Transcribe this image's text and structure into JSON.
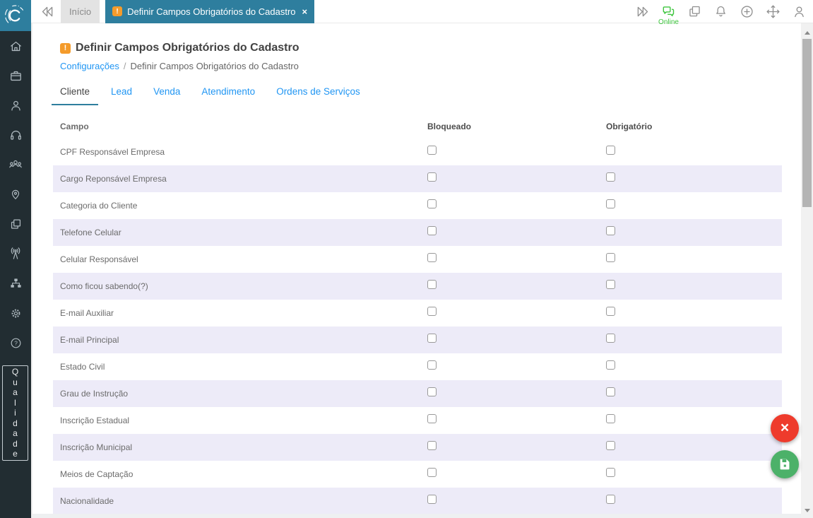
{
  "colors": {
    "accent": "#2e7e9e",
    "link_blue": "#2196f3",
    "online_green": "#3dc53d",
    "save_green": "#4cb169",
    "cancel_red": "#ee3b2c",
    "warning_orange": "#f49b2b",
    "sidebar_bg": "#222d32",
    "sidebar_icon": "#aeb9bf",
    "row_alt": "#edebf8",
    "inactive_tab_bg": "#e3e3e3"
  },
  "topbar": {
    "tabs": [
      {
        "label": "Início",
        "active": false
      },
      {
        "label": "Definir Campos Obrigatórios do Cadastro",
        "active": true,
        "warning_glyph": "!",
        "close_glyph": "×"
      }
    ],
    "right_icons": [
      "fast-forward-icon",
      "chat-icon",
      "copy-icon",
      "bell-icon",
      "add-circle-icon",
      "move-icon",
      "user-icon"
    ],
    "online_label": "Online"
  },
  "sidebar": {
    "icons": [
      "home-icon",
      "briefcase-icon",
      "user-icon",
      "headset-icon",
      "team-icon",
      "location-icon",
      "pages-icon",
      "broadcast-icon",
      "sitemap-icon",
      "settings-icon",
      "help-icon"
    ],
    "vertical_tab_label": "Qualidade"
  },
  "page": {
    "warning_glyph": "!",
    "title": "Definir Campos Obrigatórios do Cadastro",
    "breadcrumb": {
      "parent": "Configurações",
      "separator": "/",
      "current": "Definir Campos Obrigatórios do Cadastro"
    },
    "tabs": [
      {
        "label": "Cliente",
        "active": true
      },
      {
        "label": "Lead",
        "active": false
      },
      {
        "label": "Venda",
        "active": false
      },
      {
        "label": "Atendimento",
        "active": false
      },
      {
        "label": "Ordens de Serviços",
        "active": false
      }
    ]
  },
  "table": {
    "columns": [
      "Campo",
      "Bloqueado",
      "Obrigatório"
    ],
    "rows": [
      {
        "campo": "CPF Responsável Empresa",
        "bloqueado": false,
        "obrigatorio": false
      },
      {
        "campo": "Cargo Reponsável Empresa",
        "bloqueado": false,
        "obrigatorio": false
      },
      {
        "campo": "Categoria do Cliente",
        "bloqueado": false,
        "obrigatorio": false
      },
      {
        "campo": "Telefone Celular",
        "bloqueado": false,
        "obrigatorio": false
      },
      {
        "campo": "Celular Responsável",
        "bloqueado": false,
        "obrigatorio": false
      },
      {
        "campo": "Como ficou sabendo(?)",
        "bloqueado": false,
        "obrigatorio": false
      },
      {
        "campo": "E-mail Auxiliar",
        "bloqueado": false,
        "obrigatorio": false
      },
      {
        "campo": "E-mail Principal",
        "bloqueado": false,
        "obrigatorio": false
      },
      {
        "campo": "Estado Civil",
        "bloqueado": false,
        "obrigatorio": false
      },
      {
        "campo": "Grau de Instrução",
        "bloqueado": false,
        "obrigatorio": false
      },
      {
        "campo": "Inscrição Estadual",
        "bloqueado": false,
        "obrigatorio": false
      },
      {
        "campo": "Inscrição Municipal",
        "bloqueado": false,
        "obrigatorio": false
      },
      {
        "campo": "Meios de Captação",
        "bloqueado": false,
        "obrigatorio": false
      },
      {
        "campo": "Nacionalidade",
        "bloqueado": false,
        "obrigatorio": false
      }
    ]
  },
  "fab": {
    "cancel_glyph": "×"
  }
}
